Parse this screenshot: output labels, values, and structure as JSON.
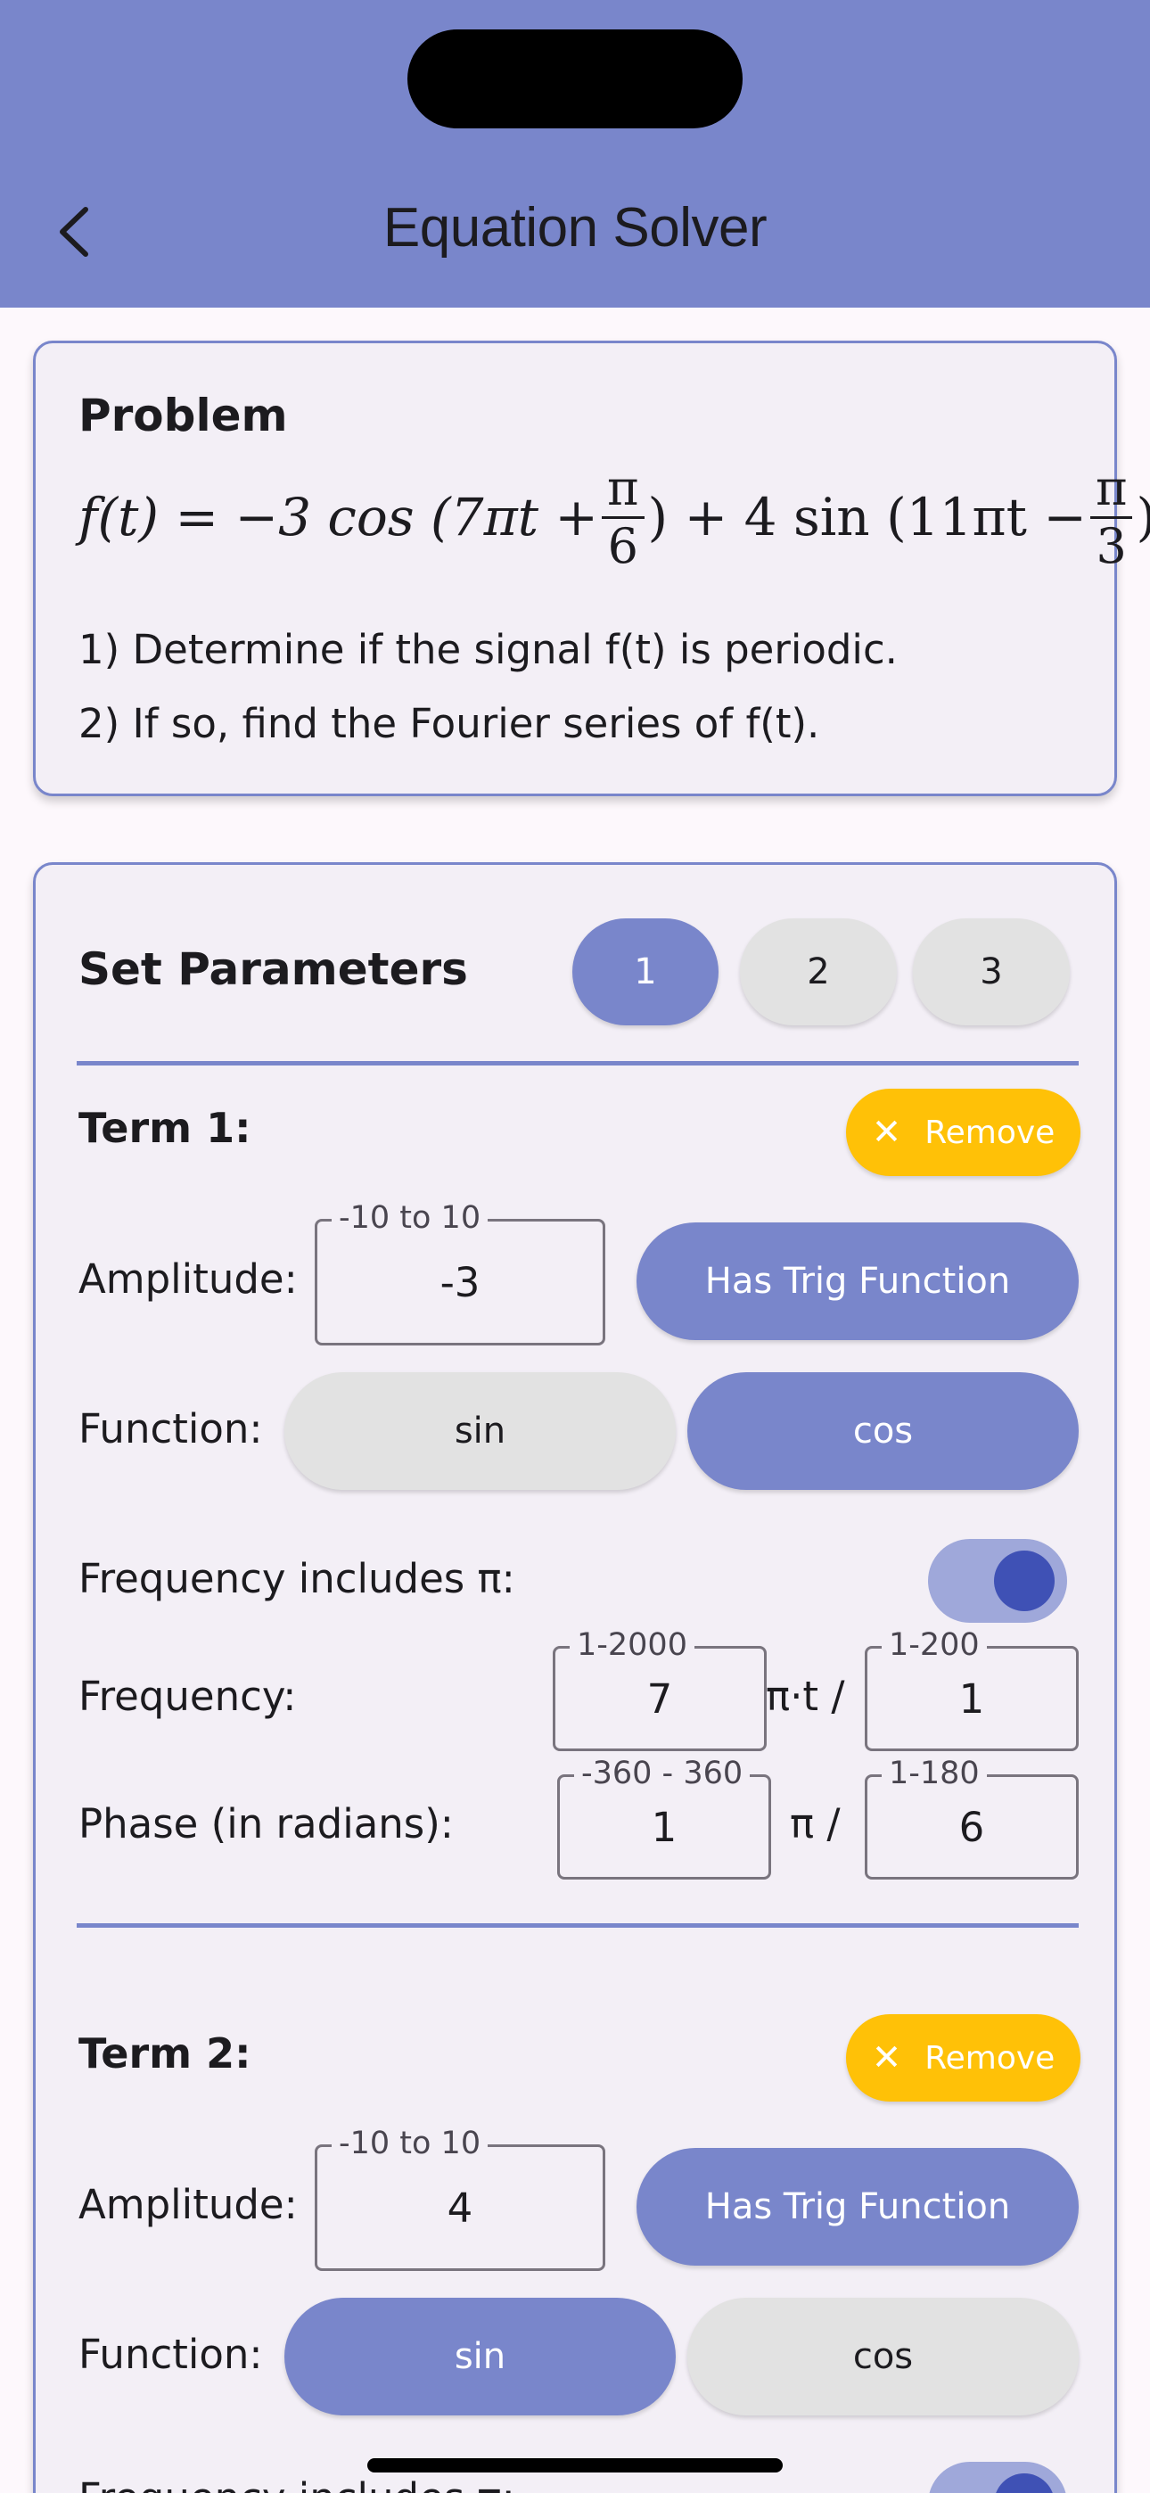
{
  "app_bar": {
    "title": "Equation Solver",
    "back_icon": "chevron-left-icon",
    "color": "#7986cb"
  },
  "problem": {
    "heading": "Problem",
    "equation": {
      "lhs": "f(t) = −3 cos (7πt +",
      "frac1_num": "π",
      "frac1_den": "6",
      "mid": ") + 4 sin (11πt −",
      "frac2_num": "π",
      "frac2_den": "3",
      "end": ")"
    },
    "line1": "1) Determine if the signal f(t) is periodic.",
    "line2": "2) If so, find the Fourier series of f(t)."
  },
  "params": {
    "heading": "Set Parameters",
    "pages": [
      "1",
      "2",
      "3"
    ],
    "active_page": "1",
    "remove_label": "Remove",
    "remove_icon": "close-icon",
    "accent": "#7986cb",
    "remove_color": "#ffc107",
    "term1": {
      "label": "Term 1:",
      "amplitude_label": "Amplitude:",
      "amplitude_hint": "-10 to 10",
      "amplitude_value": "-3",
      "trig_button": "Has Trig Function",
      "function_label": "Function:",
      "sin": "sin",
      "cos": "cos",
      "selected_function": "cos",
      "pi_label": "Frequency includes π:",
      "pi_enabled": true,
      "frequency_label": "Frequency:",
      "freq_hint": "1-2000",
      "freq_value": "7",
      "freq_sep": "π·t /",
      "freq_div_hint": "1-200",
      "freq_div_value": "1",
      "phase_label": "Phase (in radians):",
      "phase_hint": "-360 - 360",
      "phase_value": "1",
      "phase_sep": "π /",
      "phase_div_hint": "1-180",
      "phase_div_value": "6"
    },
    "term2": {
      "label": "Term 2:",
      "amplitude_label": "Amplitude:",
      "amplitude_hint": "-10 to 10",
      "amplitude_value": "4",
      "trig_button": "Has Trig Function",
      "function_label": "Function:",
      "sin": "sin",
      "cos": "cos",
      "selected_function": "sin",
      "pi_label": "Frequency includes π:",
      "pi_enabled": true
    }
  }
}
